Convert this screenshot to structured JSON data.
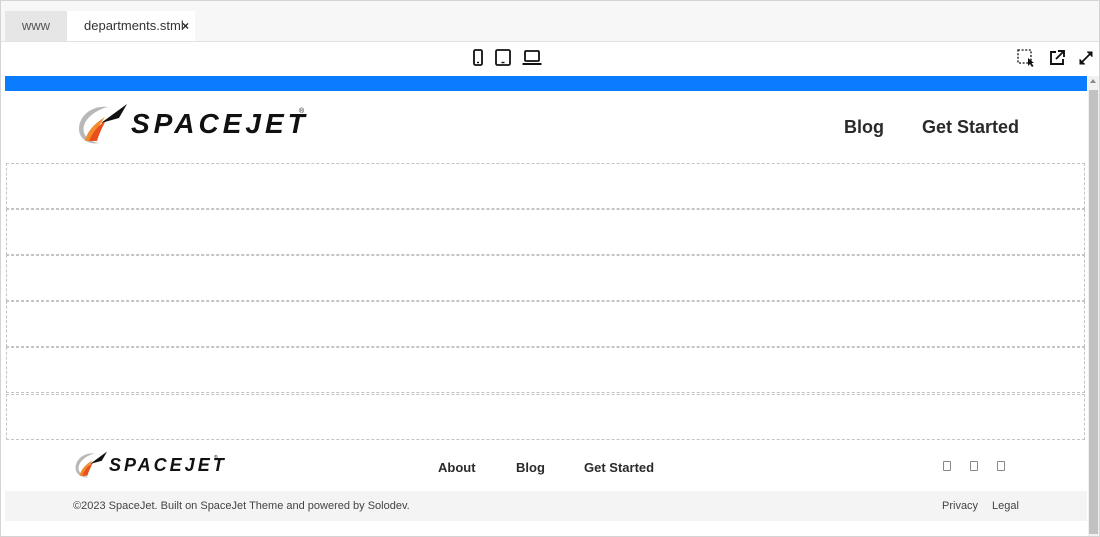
{
  "tabs": [
    {
      "label": "www",
      "active": false
    },
    {
      "label": "departments.stml",
      "active": true,
      "close": "×"
    }
  ],
  "toolbar": {
    "device_icons": [
      "mobile-icon",
      "tablet-icon",
      "laptop-icon"
    ],
    "right_icons": [
      "select-element-icon",
      "open-external-icon",
      "fullscreen-icon"
    ]
  },
  "site": {
    "accent_color": "#0a7cff",
    "header": {
      "logo_text": "SPACEJET",
      "registered_mark": "®",
      "nav": [
        "Blog",
        "Get Started"
      ]
    },
    "empty_section_count": 6,
    "footer": {
      "logo_text": "SPACEJET",
      "registered_mark": "®",
      "nav": [
        "About",
        "Blog",
        "Get Started"
      ],
      "social_icons": [
        "social-icon-1",
        "social-icon-2",
        "social-icon-3"
      ],
      "copyright": "©2023 SpaceJet. Built on SpaceJet Theme and powered by Solodev.",
      "legal_links": [
        "Privacy",
        "Legal"
      ]
    }
  }
}
